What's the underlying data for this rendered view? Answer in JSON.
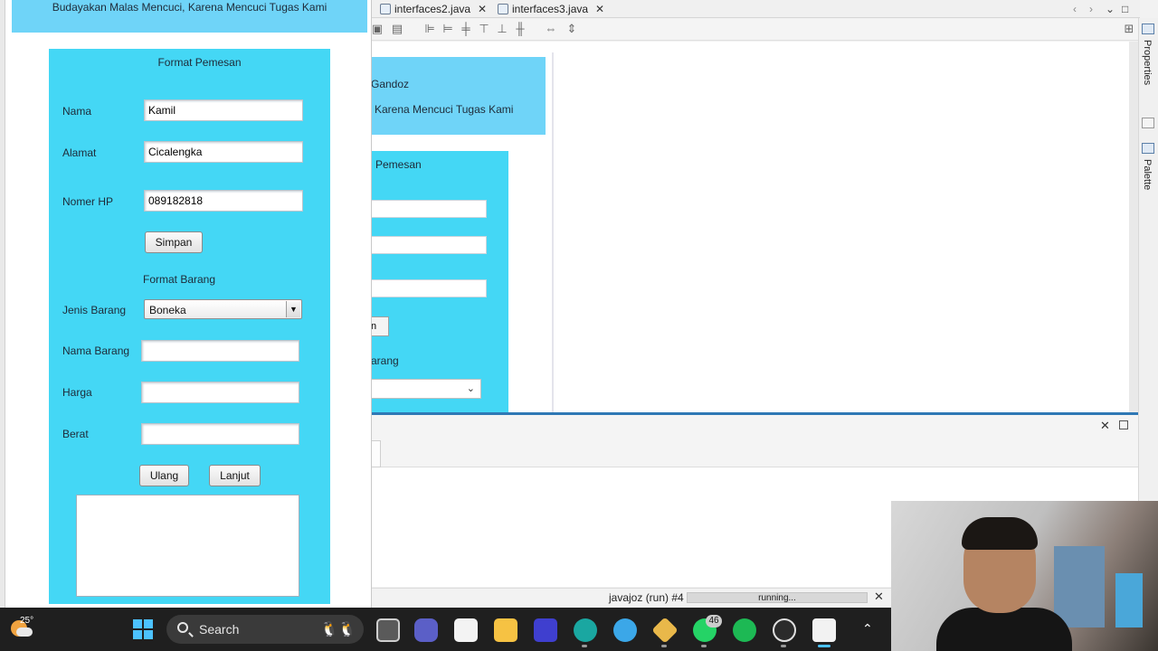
{
  "ide": {
    "tabs": [
      {
        "label": "interfaces2.java"
      },
      {
        "label": "interfaces3.java"
      }
    ],
    "tab_nav": {
      "prev": "‹",
      "next": "›",
      "menu": "⌄",
      "restore": "□"
    },
    "right_panels": {
      "properties": "Properties",
      "palette": "Palette"
    },
    "design_preview": {
      "header_line1": "Gandoz",
      "header_line2": "Karena Mencuci Tugas Kami",
      "title_partial": "Pemesan",
      "button_partial": "n",
      "section_partial": "arang"
    },
    "status": {
      "run_label": "javajoz (run) #4",
      "progress_text": "running...",
      "progress": 1.0
    },
    "close_glyph": "✕"
  },
  "app": {
    "header_tagline": "Budayakan Malas Mencuci, Karena Mencuci Tugas Kami",
    "form_title": "Format Pemesan",
    "fields": {
      "nama": {
        "label": "Nama",
        "value": "Kamil"
      },
      "alamat": {
        "label": "Alamat",
        "value": "Cicalengka"
      },
      "nomer_hp": {
        "label": "Nomer HP",
        "value": "089182818"
      }
    },
    "simpan_label": "Simpan",
    "barang_title": "Format Barang",
    "jenis_barang": {
      "label": "Jenis Barang",
      "selected": "Boneka"
    },
    "nama_barang": {
      "label": "Nama Barang",
      "value": ""
    },
    "harga": {
      "label": "Harga",
      "value": ""
    },
    "berat": {
      "label": "Berat",
      "value": ""
    },
    "ulang_label": "Ulang",
    "lanjut_label": "Lanjut",
    "output_text": ""
  },
  "taskbar": {
    "temperature": "25°",
    "search_label": "Search",
    "whatsapp_badge": "46",
    "apps": [
      {
        "name": "task-view"
      },
      {
        "name": "teams"
      },
      {
        "name": "microsoft-store"
      },
      {
        "name": "file-explorer"
      },
      {
        "name": "visual-studio"
      },
      {
        "name": "edge"
      },
      {
        "name": "canva"
      },
      {
        "name": "netbeans-cube"
      },
      {
        "name": "whatsapp"
      },
      {
        "name": "spotify"
      },
      {
        "name": "obs"
      },
      {
        "name": "java"
      }
    ]
  },
  "colors": {
    "header_blue": "#6fd4f8",
    "panel_cyan": "#44d7f5",
    "taskbar_bg": "#1f1f1f",
    "accent_blue": "#2f78b5"
  }
}
